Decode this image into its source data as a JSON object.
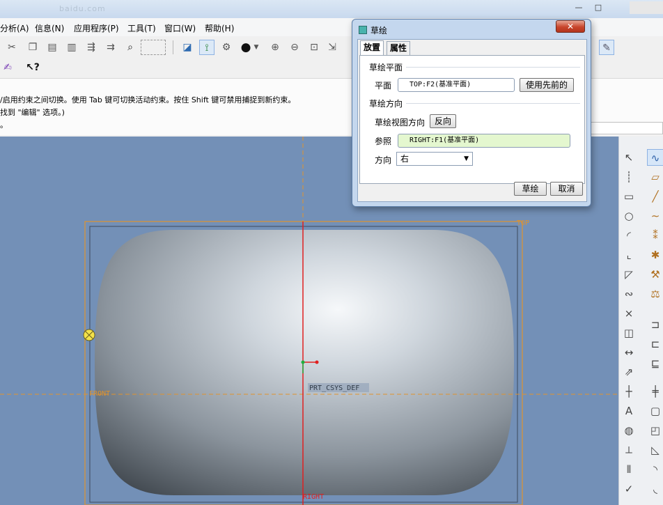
{
  "window": {
    "ghost_title": "baidu.com",
    "minimize": "—",
    "maximize": "□"
  },
  "menu": {
    "items": [
      "分析(A)",
      "信息(N)",
      "应用程序(P)",
      "工具(T)",
      "窗口(W)",
      "帮助(H)"
    ]
  },
  "toolbar": {
    "row1": [
      "cut-icon",
      "copy-icon",
      "paste-icon",
      "paste-special-icon",
      "regenerate-icon",
      "regenerate-manager-icon",
      "find-icon",
      "select-box-icon",
      "datum-display-icon",
      "axis-display-icon",
      "point-display-icon",
      "shading-icon",
      "zoom-in-icon",
      "zoom-out-icon",
      "refit-icon",
      "reorient-icon"
    ],
    "row2": [
      "sketch-pen-icon",
      "context-help-icon"
    ],
    "help_glyph": "?"
  },
  "messages": {
    "line1": "/启用约束之间切换。使用 Tab 键可切换活动约束。按住 Shift 键可禁用捕捉到新约束。",
    "line2": "找到 \"编辑\" 选项。)",
    "line3": "。"
  },
  "viewport": {
    "labels": {
      "top": "TOP",
      "front": "FRONT",
      "right": "RIGHT",
      "csys": "PRT_CSYS_DEF"
    },
    "colors": {
      "background": "#7390b7",
      "datum": "#e0932d",
      "axis": "#e02020"
    }
  },
  "dialog": {
    "title": "草绘",
    "close": "✕",
    "tabs": [
      "放置",
      "属性"
    ],
    "active_tab": "放置",
    "sketch_plane": {
      "group_label": "草绘平面",
      "plane_label": "平面",
      "plane_value": "TOP:F2(基准平面)",
      "use_previous_button": "使用先前的"
    },
    "orientation": {
      "group_label": "草绘方向",
      "view_direction_label": "草绘视图方向",
      "flip_button": "反向",
      "reference_label": "参照",
      "reference_value": "RIGHT:F1(基准平面)",
      "direction_label": "方向",
      "direction_value": "右"
    },
    "ok_button": "草绘",
    "cancel_button": "取消"
  }
}
